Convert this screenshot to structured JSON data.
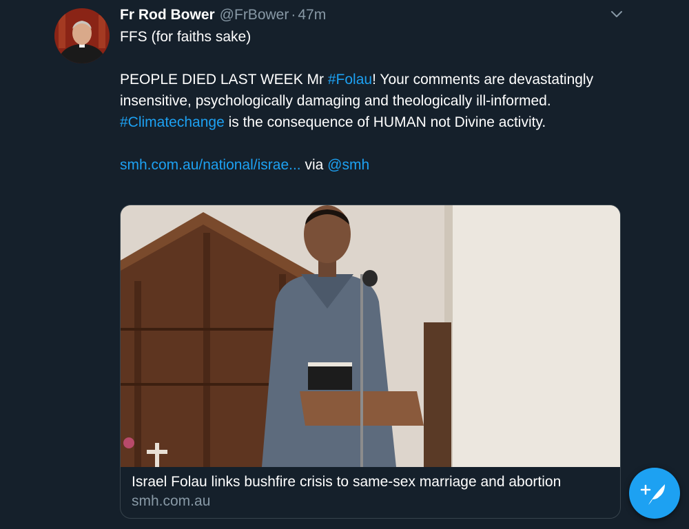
{
  "tweet": {
    "author_name": "Fr Rod Bower",
    "handle": "@FrBower",
    "separator": "·",
    "time": "47m",
    "line1": "FFS (for faiths sake)",
    "p2_before": "PEOPLE DIED LAST WEEK Mr ",
    "hashtag_folau": "#Folau",
    "p2_after": "! Your comments are devastatingly insensitive, psychologically damaging and theologically ill-informed.",
    "hashtag_climate": "#Climatechange",
    "p3_after": " is the consequence of HUMAN not Divine activity.",
    "url": "smh.com.au/national/israe...",
    "via": " via ",
    "mention": "@smh"
  },
  "card": {
    "title": "Israel Folau links bushfire crisis to same-sex marriage and abortion",
    "domain": "smh.com.au"
  },
  "icons": {
    "menu": "chevron-down-icon",
    "compose": "compose-tweet-icon"
  },
  "colors": {
    "background": "#15202b",
    "accent": "#1da1f2",
    "secondary_text": "#8899a6",
    "border": "#38444d"
  }
}
